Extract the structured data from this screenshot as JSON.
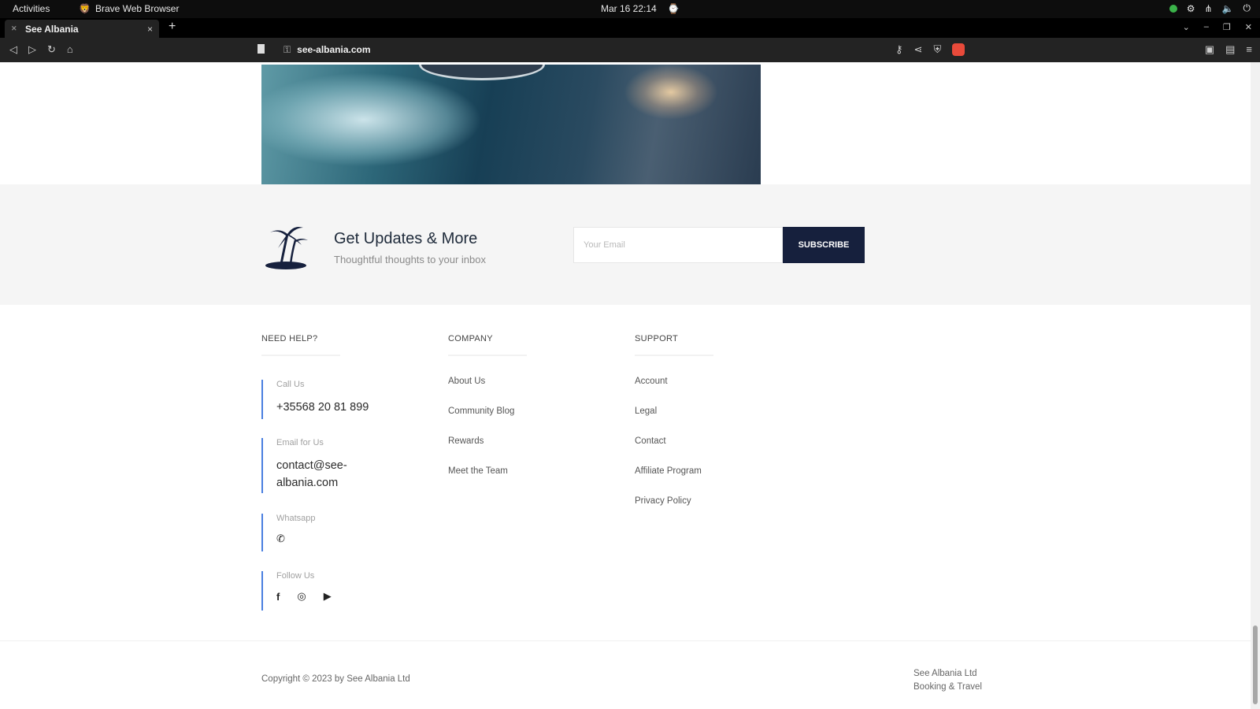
{
  "system_bar": {
    "activities": "Activities",
    "app_name": "Brave Web Browser",
    "datetime": "Mar 16 22:14"
  },
  "browser": {
    "tab_title": "See Albania",
    "url": "see-albania.com"
  },
  "newsletter": {
    "title": "Get Updates & More",
    "subtitle": "Thoughtful thoughts to your inbox",
    "email_placeholder": "Your Email",
    "subscribe_label": "SUBSCRIBE"
  },
  "footer": {
    "need_help": {
      "title": "NEED HELP?",
      "call_label": "Call Us",
      "call_value": "+35568 20 81 899",
      "email_label": "Email for Us",
      "email_value": "contact@see-albania.com",
      "whatsapp_label": "Whatsapp",
      "follow_label": "Follow Us"
    },
    "company": {
      "title": "COMPANY",
      "links": [
        "About Us",
        "Community Blog",
        "Rewards",
        "Meet the Team"
      ]
    },
    "support": {
      "title": "SUPPORT",
      "links": [
        "Account",
        "Legal",
        "Contact",
        "Affiliate Program",
        "Privacy Policy"
      ]
    },
    "copyright": "Copyright © 2023 by See Albania Ltd",
    "company_name": "See Albania Ltd",
    "company_tagline": "Booking & Travel"
  },
  "colors": {
    "accent_navy": "#16203d",
    "help_border": "#4a7fe0",
    "band_bg": "#f5f5f5"
  },
  "icons": {
    "social": [
      "facebook-icon",
      "instagram-icon",
      "youtube-icon"
    ],
    "brand": "palm-tree-island-icon"
  }
}
